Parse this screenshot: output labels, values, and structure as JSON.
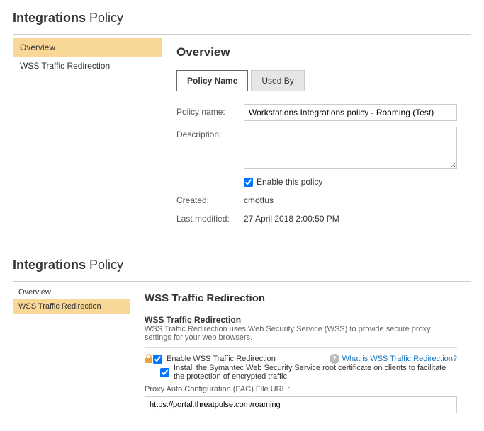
{
  "panel1": {
    "title_bold": "Integrations",
    "title_rest": "Policy",
    "sidebar": {
      "items": [
        {
          "label": "Overview",
          "active": true
        },
        {
          "label": "WSS Traffic Redirection",
          "active": false
        }
      ]
    },
    "content": {
      "heading": "Overview",
      "tabs": [
        {
          "label": "Policy Name",
          "active": true
        },
        {
          "label": "Used By",
          "active": false
        }
      ],
      "policy_name_label": "Policy name:",
      "policy_name_value": "Workstations Integrations policy - Roaming (Test)",
      "description_label": "Description:",
      "description_value": "",
      "enable_label": "Enable this policy",
      "created_label": "Created:",
      "created_value": "cmottus",
      "modified_label": "Last modified:",
      "modified_value": "27 April 2018 2:00:50 PM"
    }
  },
  "panel2": {
    "title_bold": "Integrations",
    "title_rest": "Policy",
    "sidebar": {
      "items": [
        {
          "label": "Overview",
          "active": false
        },
        {
          "label": "WSS Traffic Redirection",
          "active": true
        }
      ]
    },
    "content": {
      "heading": "WSS Traffic Redirection",
      "sub_title": "WSS Traffic Redirection",
      "sub_desc": "WSS Traffic Redirection uses Web Security Service (WSS) to provide secure proxy settings for your web browsers.",
      "enable_wss_label": "Enable WSS Traffic Redirection",
      "help_link": "What is WSS Traffic Redirection?",
      "install_cert_label": "Install the Symantec Web Security Service root certificate on clients to facilitate the protection of encrypted traffic",
      "pac_label": "Proxy Auto Configuration (PAC) File URL :",
      "pac_value": "https://portal.threatpulse.com/roaming"
    }
  }
}
